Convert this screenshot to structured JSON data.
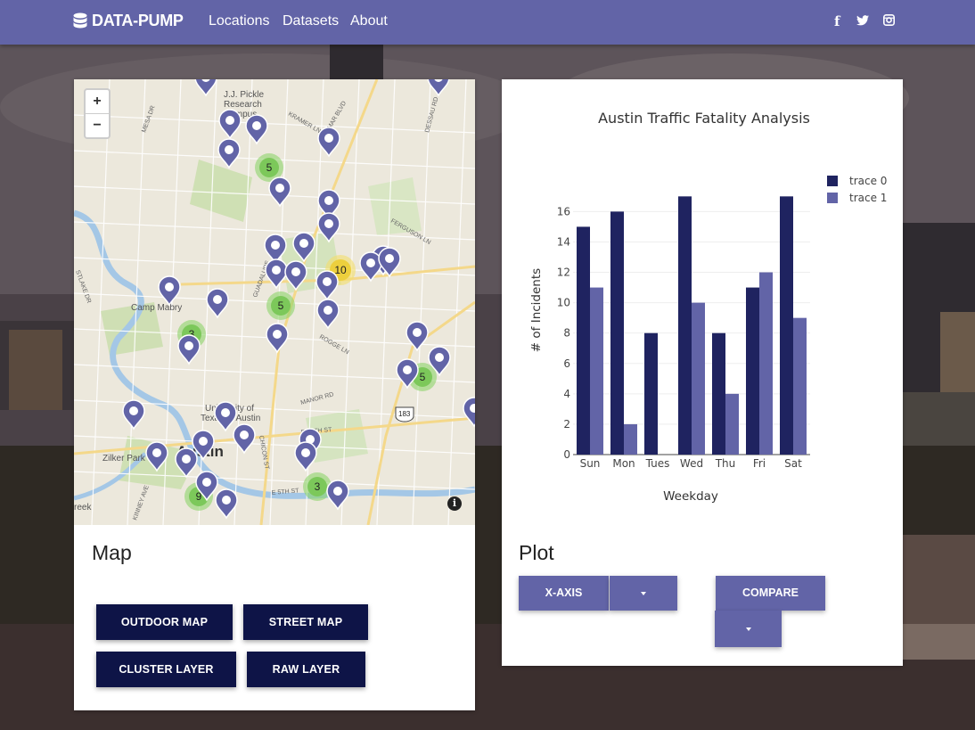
{
  "navbar": {
    "brand": "DATA-PUMP",
    "links": [
      "Locations",
      "Datasets",
      "About"
    ],
    "social": [
      {
        "icon": "facebook-icon",
        "glyph": "f"
      },
      {
        "icon": "twitter-icon",
        "glyph": "t"
      },
      {
        "icon": "instagram-icon",
        "glyph": "◎"
      }
    ]
  },
  "map": {
    "title": "Map",
    "zoom_in": "+",
    "zoom_out": "−",
    "info": "i",
    "labels": {
      "pickle": "J.J. Pickle",
      "research": "Research",
      "campus": "Campus",
      "camp_mabry": "Camp Mabry",
      "univ": "University of",
      "texas_austin": "Texas at Austin",
      "austin": "Austin",
      "zilker": "Zilker Park",
      "creek": "reek",
      "route": "183",
      "streets": [
        "KRAMER LN",
        "N LAMAR BLVD",
        "DESSAU RD",
        "MESA DR",
        "FERGUSON LN",
        "GUADALUPE",
        "ROGGE LN",
        "MANOR RD",
        "E 12TH ST",
        "E 5TH ST",
        "CHICON ST",
        "KINNEY AVE",
        "STLAKE DR"
      ]
    },
    "clusters": [
      "5",
      "10",
      "5",
      "3",
      "3",
      "5",
      "9"
    ],
    "buttons": {
      "outdoor": "OUTDOOR MAP",
      "street": "STREET MAP",
      "cluster": "CLUSTER LAYER",
      "raw": "RAW LAYER"
    }
  },
  "plot": {
    "title": "Plot",
    "buttons": {
      "xaxis": "X-AXIS",
      "compare": "COMPARE"
    }
  },
  "chart_data": {
    "type": "bar",
    "title": "Austin Traffic Fatality Analysis",
    "xlabel": "Weekday",
    "ylabel": "# of Incidents",
    "categories": [
      "Sun",
      "Mon",
      "Tues",
      "Wed",
      "Thu",
      "Fri",
      "Sat"
    ],
    "series": [
      {
        "name": "trace 0",
        "values": [
          15,
          16,
          8,
          17,
          8,
          11,
          17
        ],
        "color": "#1f2360"
      },
      {
        "name": "trace 1",
        "values": [
          11,
          2,
          0,
          10,
          4,
          12,
          9
        ],
        "color": "#6264a7"
      }
    ],
    "ylim": [
      0,
      17.9
    ],
    "yticks": [
      0,
      2,
      4,
      6,
      8,
      10,
      12,
      14,
      16
    ],
    "grid": true,
    "legend": "top-right"
  }
}
